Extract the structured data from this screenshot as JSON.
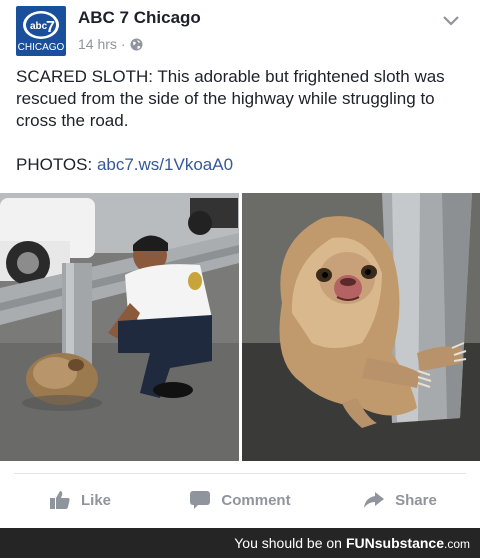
{
  "post": {
    "page_name": "ABC 7 Chicago",
    "timestamp": "14 hrs",
    "separator": "·",
    "avatar_text": "CHICAGO",
    "avatar_number": "7",
    "body": "SCARED SLOTH: This adorable but frightened sloth was rescued from the side of the highway while struggling to cross the road.",
    "photos_label": "PHOTOS:",
    "photos_link": "abc7.ws/1VkoaA0"
  },
  "actions": {
    "like": "Like",
    "comment": "Comment",
    "share": "Share"
  },
  "footer": {
    "tagline": "You should be on",
    "brand_fun": "FUNsubstance",
    "brand_domain": ".com"
  },
  "colors": {
    "avatar_bg": "#1a4f9c",
    "link": "#365899",
    "muted": "#90949c",
    "footer_bg": "#252525"
  }
}
